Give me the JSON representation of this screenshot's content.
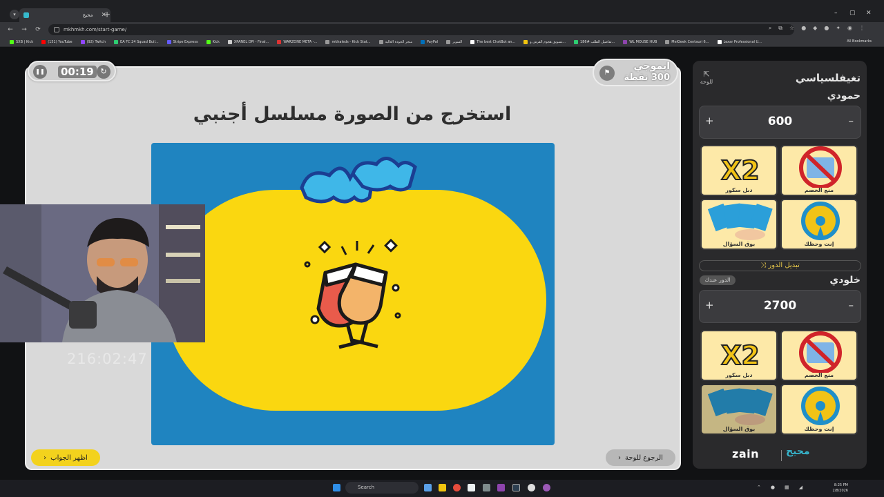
{
  "browser": {
    "tab_title": "محيح",
    "url": "mkhmkh.com/start-game/",
    "bookmarks": [
      {
        "label": "SXB | Kick",
        "color": "#53fc18"
      },
      {
        "label": "(151) YouTube",
        "color": "#ff0000"
      },
      {
        "label": "(92) Twitch",
        "color": "#9146ff"
      },
      {
        "label": "EA FC 24 Squad Buil...",
        "color": "#2ecc71"
      },
      {
        "label": "Stripe Express",
        "color": "#635bff"
      },
      {
        "label": "Kick",
        "color": "#53fc18"
      },
      {
        "label": "XPANEL DPI - Final...",
        "color": "#cccccc"
      },
      {
        "label": "WARZONE META -...",
        "color": "#d33"
      },
      {
        "label": "mkhaleds - Kick Stat...",
        "color": "#999"
      },
      {
        "label": "متجر الجودة العالية",
        "color": "#999"
      },
      {
        "label": "PayPal",
        "color": "#0070ba"
      },
      {
        "label": "السوبر",
        "color": "#999"
      },
      {
        "label": "The best ChatBot an...",
        "color": "#fff"
      },
      {
        "label": "تسويق هجوم القرش و...",
        "color": "#f1c40f"
      },
      {
        "label": "تفاصيل الطلب #186...",
        "color": "#2ecc71"
      },
      {
        "label": "WL MOUSE HUB",
        "color": "#8e44ad"
      },
      {
        "label": "MelGeek Centauri 6...",
        "color": "#999"
      },
      {
        "label": "Lexar Professional U...",
        "color": "#fff"
      }
    ],
    "all_bookmarks": "All Bookmarks"
  },
  "game": {
    "timer": "00:19",
    "category_name": "ايموجي",
    "category_points": "300 نقطة",
    "question": "استخرج من الصورة مسلسل أجنبي",
    "logo_text": "محيح",
    "show_answer": "اظهر الجواب",
    "back_to_board": "الرجوع للوحة"
  },
  "stream": {
    "elapsed": "216:02:47"
  },
  "panel": {
    "title": "تغيفلسياسي",
    "home_label": "للوحة",
    "switch_turn": "تبديل الدور",
    "turn_badge": "الدور عندك",
    "teams": [
      {
        "name": "حمودي",
        "score": "600",
        "aids": [
          "دبل سكور",
          "منع الخصم",
          "بوق السؤال",
          "إنت وحظك"
        ]
      },
      {
        "name": "خلودي",
        "score": "2700",
        "aids": [
          "دبل سكور",
          "منع الخصم",
          "بوق السؤال",
          "إنت وحظك"
        ]
      }
    ],
    "sponsor": "zain"
  },
  "taskbar": {
    "search": "Search",
    "time": "8:25 PM",
    "date": "2/8/2026"
  }
}
